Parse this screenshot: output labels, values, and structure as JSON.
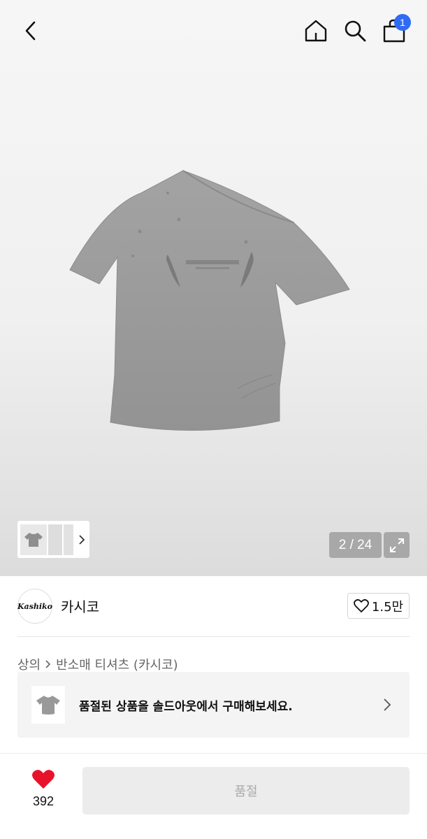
{
  "header": {
    "cart_badge": "1"
  },
  "gallery": {
    "counter": "2 / 24"
  },
  "brand": {
    "logo_text": "Kashiko",
    "name": "카시코",
    "likes": "1.5만"
  },
  "breadcrumb": {
    "category": "상의",
    "subcategory": "반소매 티셔츠 (카시코)"
  },
  "soldout_banner": {
    "text": "품절된 상품을 솔드아웃에서 구매해보세요."
  },
  "bottom_bar": {
    "wish_count": "392",
    "buy_label": "품절"
  },
  "colors": {
    "badge": "#2f6cf6",
    "heart": "#e8122a",
    "shirt": "#9a9a9a"
  }
}
